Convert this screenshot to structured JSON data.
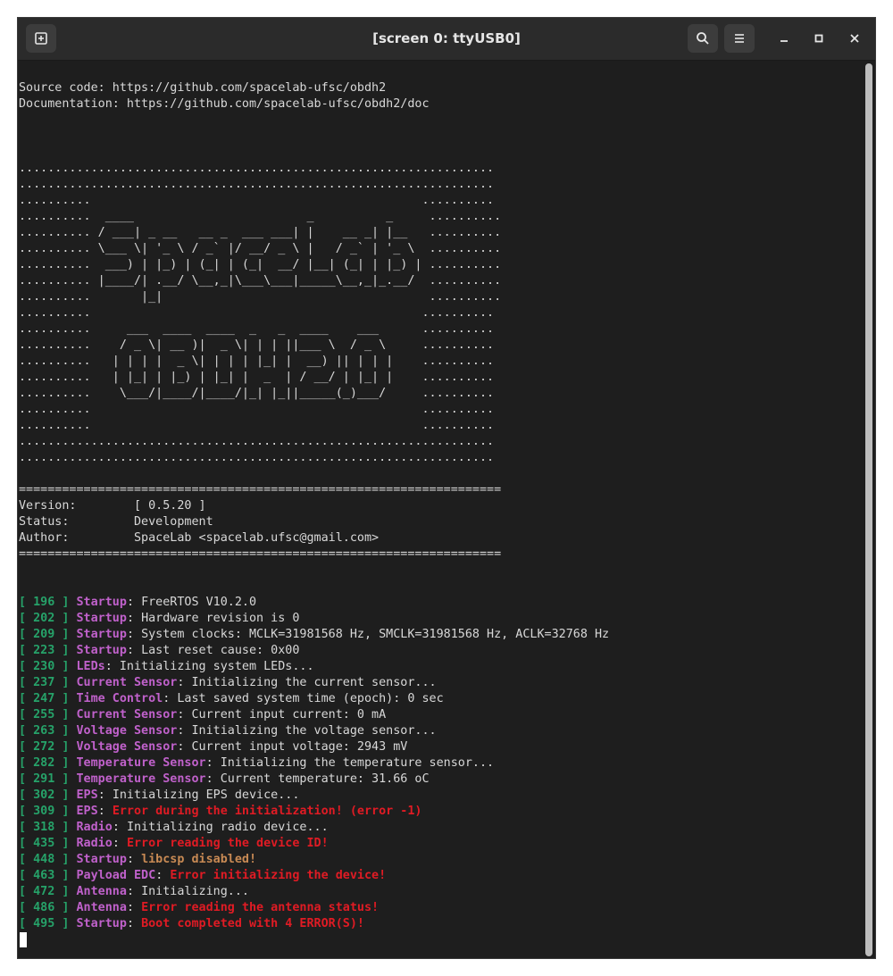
{
  "window": {
    "title": "[screen 0: ttyUSB0]",
    "icons": {
      "new_tab": "new-tab-icon",
      "search": "search-icon",
      "menu": "hamburger-menu-icon",
      "minimize": "minimize-icon",
      "maximize": "maximize-icon",
      "close": "close-icon"
    }
  },
  "colors": {
    "background": "#1e1e1e",
    "text": "#d8d8d8",
    "timestamp": "#26a269",
    "tag": "#c061cb",
    "error": "#e01b24",
    "warning": "#c88a54"
  },
  "header": {
    "source": "Source code: https://github.com/spacelab-ufsc/obdh2",
    "docs": "Documentation: https://github.com/spacelab-ufsc/obdh2/doc"
  },
  "banner": [
    "..................................................................",
    "..................................................................",
    "..........                                              ..........",
    "..........  ____                        _          _     ..........",
    ".......... / ___| _ __   __ _  ___ ___| |    __ _| |__   ..........",
    ".......... \\___ \\| '_ \\ / _` |/ __/ _ \\ |   / _` | '_ \\  ..........",
    "..........  ___) | |_) | (_| | (_|  __/ |__| (_| | |_) | ..........",
    ".......... |____/| .__/ \\__,_|\\___\\___|_____\\__,_|_.__/  ..........",
    "..........       |_|                                     ..........",
    "..........                                              ..........",
    "..........     ___  ____  ____  _   _  ____    ___      ..........",
    "..........    / _ \\| __ )|  _ \\| | | ||___ \\  / _ \\     ..........",
    "..........   | | | |  _ \\| | | | |_| |  __) || | | |    ..........",
    "..........   | |_| | |_) | |_| |  _  | / __/ | |_| |    ..........",
    "..........    \\___/|____/|____/|_| |_||_____(_)___/     ..........",
    "..........                                              ..........",
    "..........                                              ..........",
    "..................................................................",
    ".................................................................."
  ],
  "info": {
    "separator": "===================================================================",
    "version": "Version:        [ 0.5.20 ]",
    "status": "Status:         Development",
    "author": "Author:         SpaceLab <spacelab.ufsc@gmail.com>"
  },
  "log": [
    {
      "ts": "[ 196 ]",
      "tag": "Startup",
      "msg": "FreeRTOS V10.2.0",
      "level": "info"
    },
    {
      "ts": "[ 202 ]",
      "tag": "Startup",
      "msg": "Hardware revision is 0",
      "level": "info"
    },
    {
      "ts": "[ 209 ]",
      "tag": "Startup",
      "msg": "System clocks: MCLK=31981568 Hz, SMCLK=31981568 Hz, ACLK=32768 Hz",
      "level": "info"
    },
    {
      "ts": "[ 223 ]",
      "tag": "Startup",
      "msg": "Last reset cause: 0x00",
      "level": "info"
    },
    {
      "ts": "[ 230 ]",
      "tag": "LEDs",
      "msg": "Initializing system LEDs...",
      "level": "info"
    },
    {
      "ts": "[ 237 ]",
      "tag": "Current Sensor",
      "msg": "Initializing the current sensor...",
      "level": "info"
    },
    {
      "ts": "[ 247 ]",
      "tag": "Time Control",
      "msg": "Last saved system time (epoch): 0 sec",
      "level": "info"
    },
    {
      "ts": "[ 255 ]",
      "tag": "Current Sensor",
      "msg": "Current input current: 0 mA",
      "level": "info"
    },
    {
      "ts": "[ 263 ]",
      "tag": "Voltage Sensor",
      "msg": "Initializing the voltage sensor...",
      "level": "info"
    },
    {
      "ts": "[ 272 ]",
      "tag": "Voltage Sensor",
      "msg": "Current input voltage: 2943 mV",
      "level": "info"
    },
    {
      "ts": "[ 282 ]",
      "tag": "Temperature Sensor",
      "msg": "Initializing the temperature sensor...",
      "level": "info"
    },
    {
      "ts": "[ 291 ]",
      "tag": "Temperature Sensor",
      "msg": "Current temperature: 31.66 oC",
      "level": "info"
    },
    {
      "ts": "[ 302 ]",
      "tag": "EPS",
      "msg": "Initializing EPS device...",
      "level": "info"
    },
    {
      "ts": "[ 309 ]",
      "tag": "EPS",
      "msg": "Error during the initialization! (error -1)",
      "level": "error"
    },
    {
      "ts": "[ 318 ]",
      "tag": "Radio",
      "msg": "Initializing radio device...",
      "level": "info"
    },
    {
      "ts": "[ 435 ]",
      "tag": "Radio",
      "msg": "Error reading the device ID!",
      "level": "error"
    },
    {
      "ts": "[ 448 ]",
      "tag": "Startup",
      "msg": "libcsp disabled!",
      "level": "warning"
    },
    {
      "ts": "[ 463 ]",
      "tag": "Payload EDC",
      "msg": "Error initializing the device!",
      "level": "error"
    },
    {
      "ts": "[ 472 ]",
      "tag": "Antenna",
      "msg": "Initializing...",
      "level": "info"
    },
    {
      "ts": "[ 486 ]",
      "tag": "Antenna",
      "msg": "Error reading the antenna status!",
      "level": "error"
    },
    {
      "ts": "[ 495 ]",
      "tag": "Startup",
      "msg": "Boot completed with 4 ERROR(S)!",
      "level": "error"
    }
  ]
}
